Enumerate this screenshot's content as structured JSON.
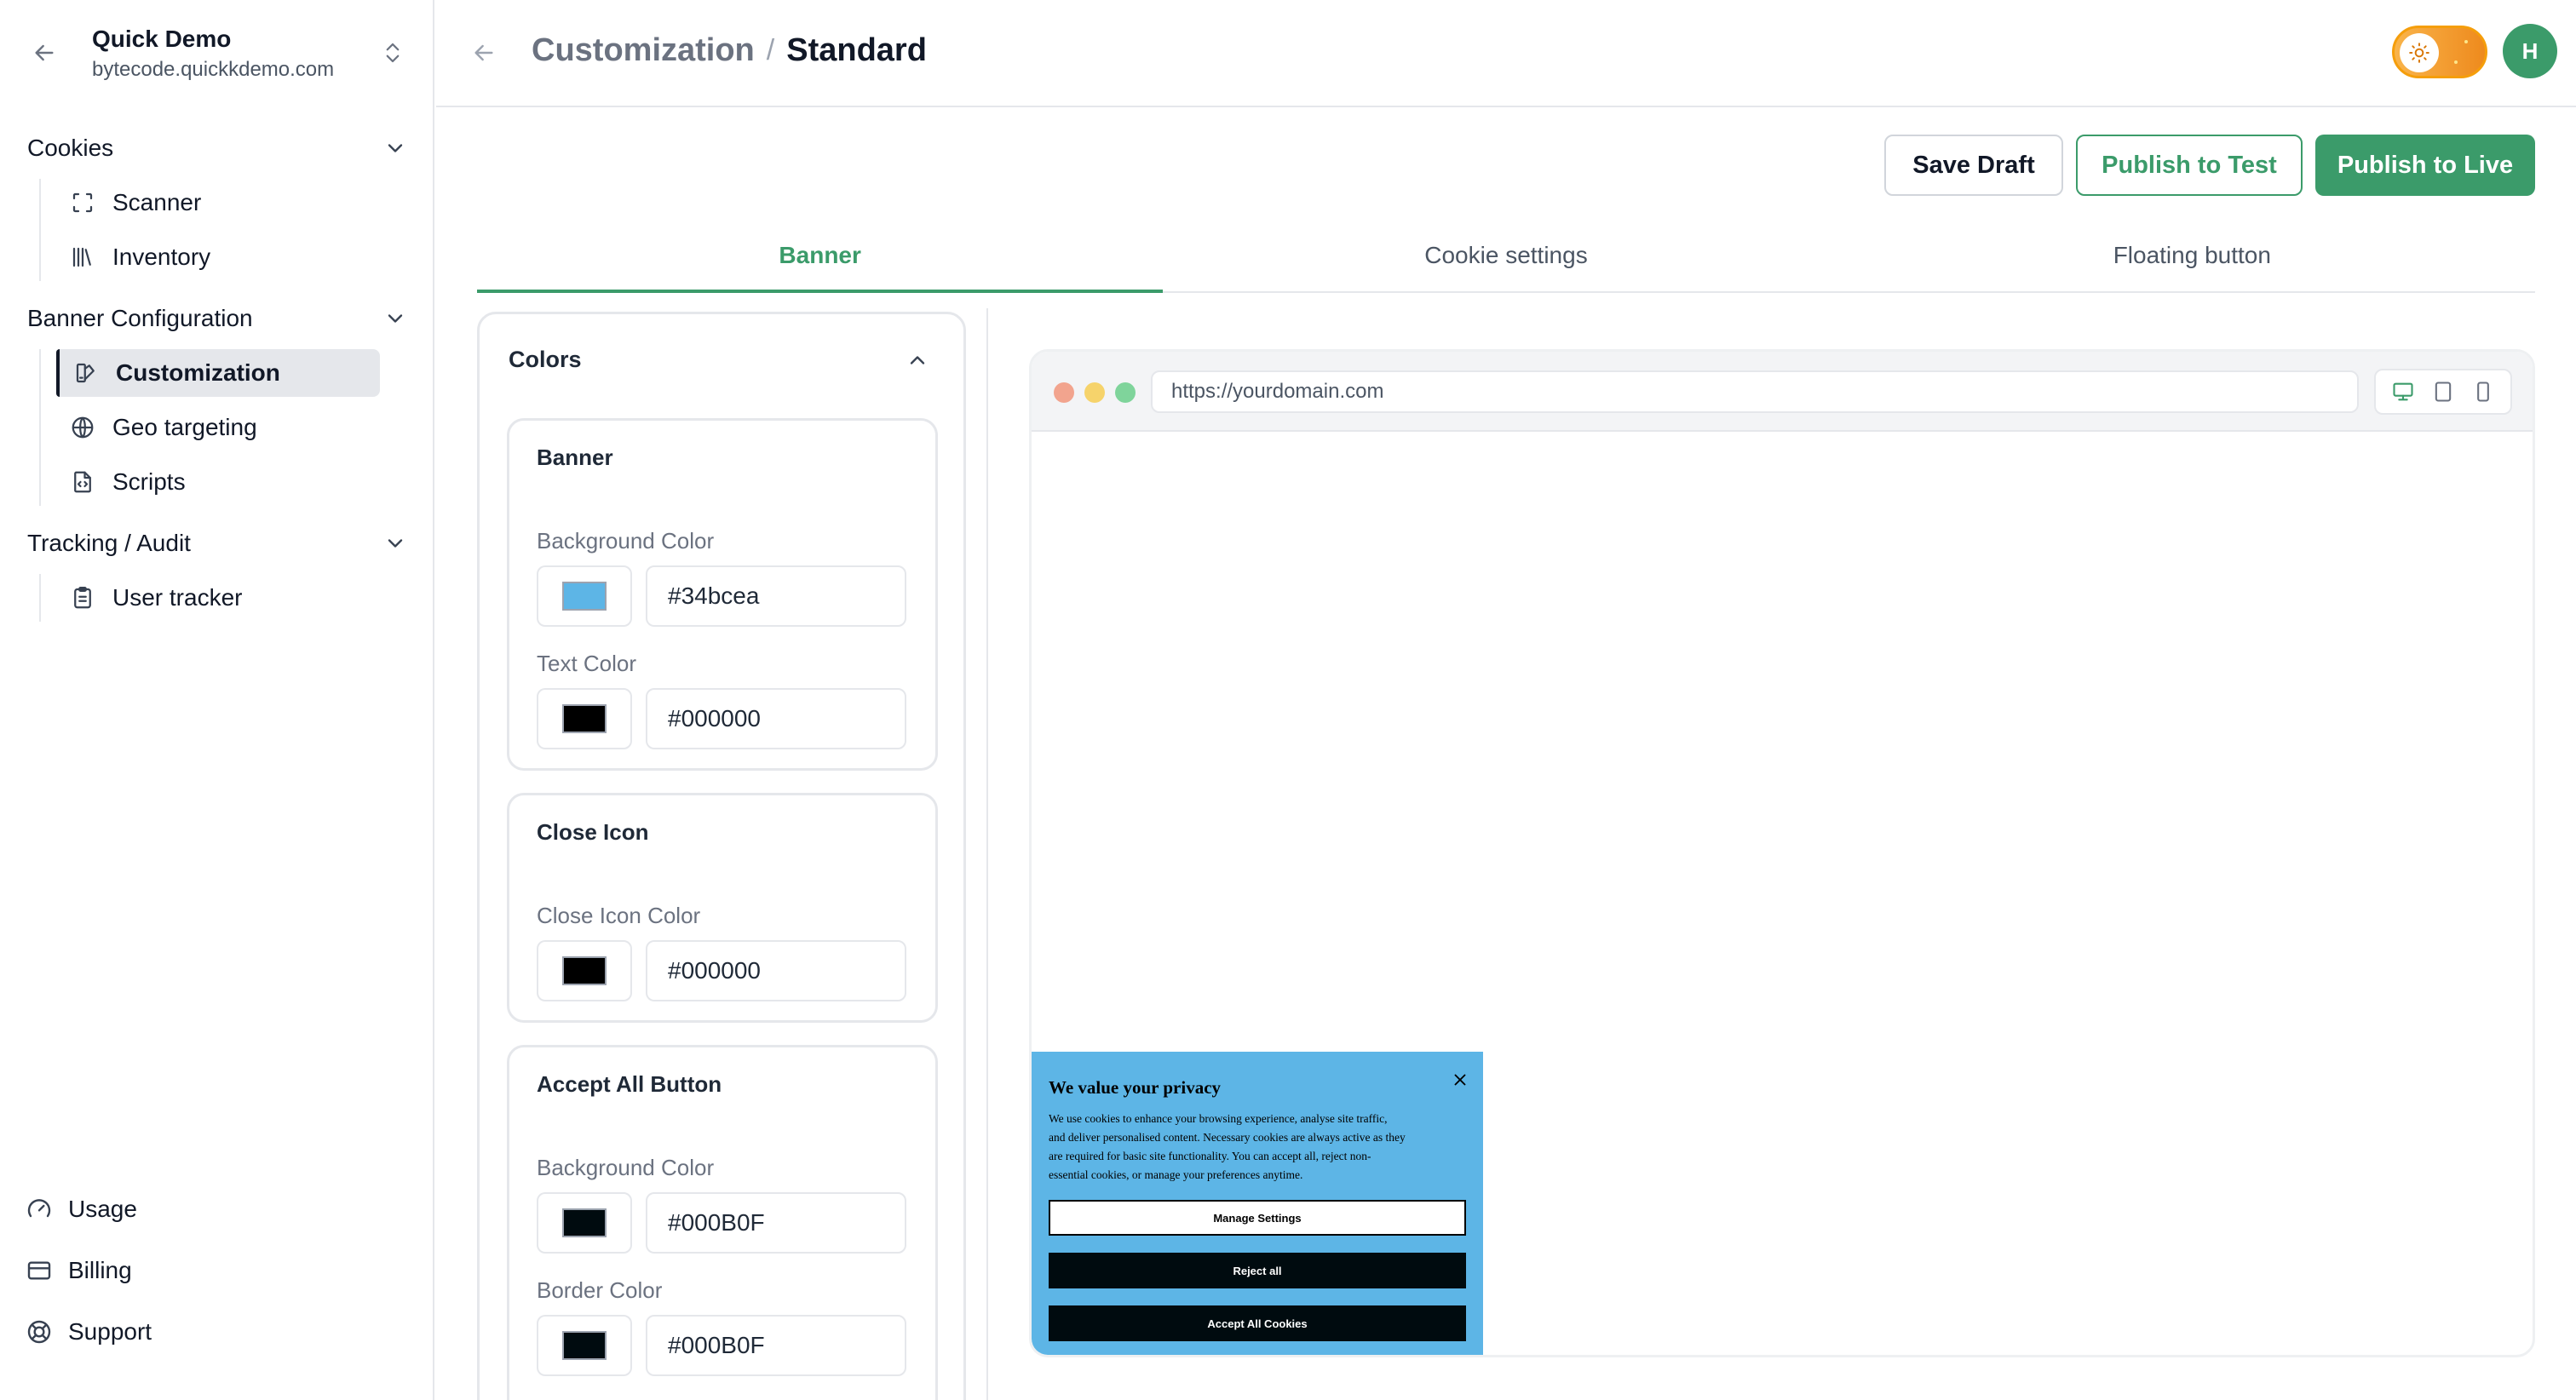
{
  "org": {
    "name": "Quick Demo",
    "domain": "bytecode.quickkdemo.com"
  },
  "sidebar": {
    "groups": [
      {
        "label": "Cookies",
        "items": [
          {
            "label": "Scanner",
            "icon": "scan-icon"
          },
          {
            "label": "Inventory",
            "icon": "library-icon"
          }
        ]
      },
      {
        "label": "Banner Configuration",
        "items": [
          {
            "label": "Customization",
            "icon": "brush-icon"
          },
          {
            "label": "Geo targeting",
            "icon": "globe-icon"
          },
          {
            "label": "Scripts",
            "icon": "file-code-icon"
          }
        ]
      },
      {
        "label": "Tracking / Audit",
        "items": [
          {
            "label": "User tracker",
            "icon": "clipboard-icon"
          }
        ]
      }
    ],
    "bottom": [
      {
        "label": "Usage",
        "icon": "gauge-icon"
      },
      {
        "label": "Billing",
        "icon": "credit-card-icon"
      },
      {
        "label": "Support",
        "icon": "life-buoy-icon"
      }
    ],
    "active_item": "Customization"
  },
  "header": {
    "breadcrumb": {
      "parent": "Customization",
      "separator": "/",
      "current": "Standard"
    },
    "avatar_initial": "H"
  },
  "actions": {
    "save_draft": "Save Draft",
    "publish_test": "Publish to Test",
    "publish_live": "Publish to Live"
  },
  "tabs": [
    {
      "label": "Banner",
      "active": true
    },
    {
      "label": "Cookie settings",
      "active": false
    },
    {
      "label": "Floating button",
      "active": false
    }
  ],
  "colors_panel": {
    "title": "Colors",
    "sections": [
      {
        "title": "Banner",
        "fields": [
          {
            "label": "Background Color",
            "value": "#34bcea",
            "swatch": "#5db5e6"
          },
          {
            "label": "Text Color",
            "value": "#000000",
            "swatch": "#000000"
          }
        ]
      },
      {
        "title": "Close Icon",
        "fields": [
          {
            "label": "Close Icon Color",
            "value": "#000000",
            "swatch": "#000000"
          }
        ]
      },
      {
        "title": "Accept All Button",
        "fields": [
          {
            "label": "Background Color",
            "value": "#000B0F",
            "swatch": "#000b0f"
          },
          {
            "label": "Border Color",
            "value": "#000B0F",
            "swatch": "#000b0f"
          }
        ]
      }
    ]
  },
  "preview": {
    "url": "https://yourdomain.com",
    "banner": {
      "title": "We value your privacy",
      "text_lines": [
        "We use cookies to enhance your browsing experience, analyse site traffic,",
        "and deliver personalised content. Necessary cookies are always active as they",
        "are required for basic site functionality. You can accept all, reject non-",
        "essential cookies, or manage your preferences anytime."
      ],
      "manage_label": "Manage Settings",
      "reject_label": "Reject all",
      "accept_label": "Accept All Cookies"
    }
  },
  "theme": {
    "accent": "#3b9b6a",
    "toggle": "#f59e0b",
    "border": "#e5e7eb"
  }
}
